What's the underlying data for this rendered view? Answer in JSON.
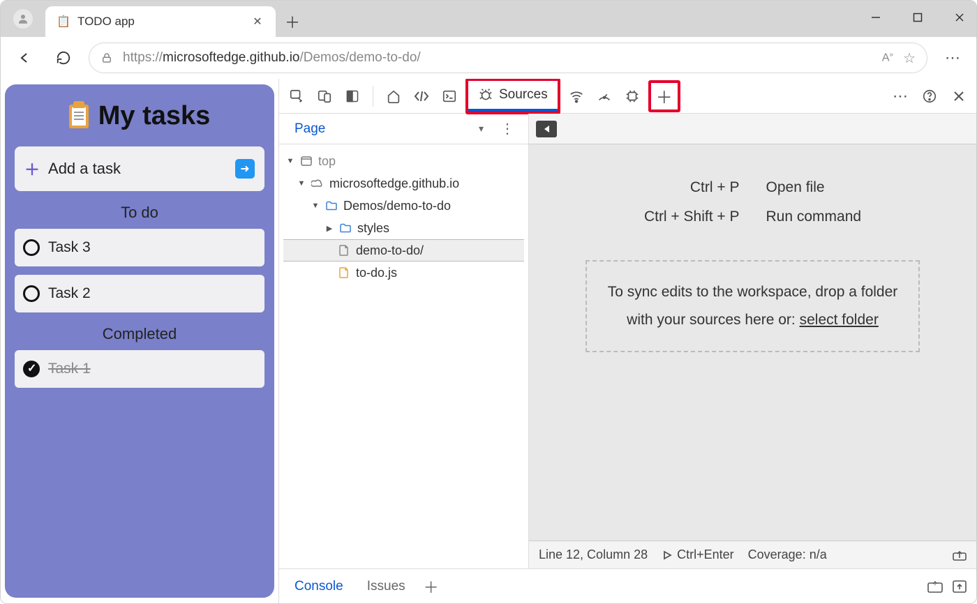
{
  "browser": {
    "tab_title": "TODO app",
    "url_prefix": "https://",
    "url_host": "microsoftedge.github.io",
    "url_path": "/Demos/demo-to-do/"
  },
  "app": {
    "title": "My tasks",
    "add_label": "Add a task",
    "todo_heading": "To do",
    "completed_heading": "Completed",
    "todo": [
      "Task 3",
      "Task 2"
    ],
    "done": [
      "Task 1"
    ]
  },
  "devtools": {
    "sources_label": "Sources",
    "nav_tab": "Page",
    "tree": {
      "top": "top",
      "host": "microsoftedge.github.io",
      "folder": "Demos/demo-to-do",
      "styles": "styles",
      "index": "demo-to-do/",
      "js": "to-do.js"
    },
    "shortcuts": {
      "open_key": "Ctrl + P",
      "open_label": "Open file",
      "run_key": "Ctrl + Shift + P",
      "run_label": "Run command"
    },
    "dropzone": {
      "line1": "To sync edits to the workspace, drop a folder",
      "line2_a": "with your sources here or: ",
      "link": "select folder"
    },
    "status": {
      "position": "Line 12, Column 28",
      "run_hint": "Ctrl+Enter",
      "coverage": "Coverage: n/a"
    },
    "drawer": {
      "console": "Console",
      "issues": "Issues"
    }
  }
}
